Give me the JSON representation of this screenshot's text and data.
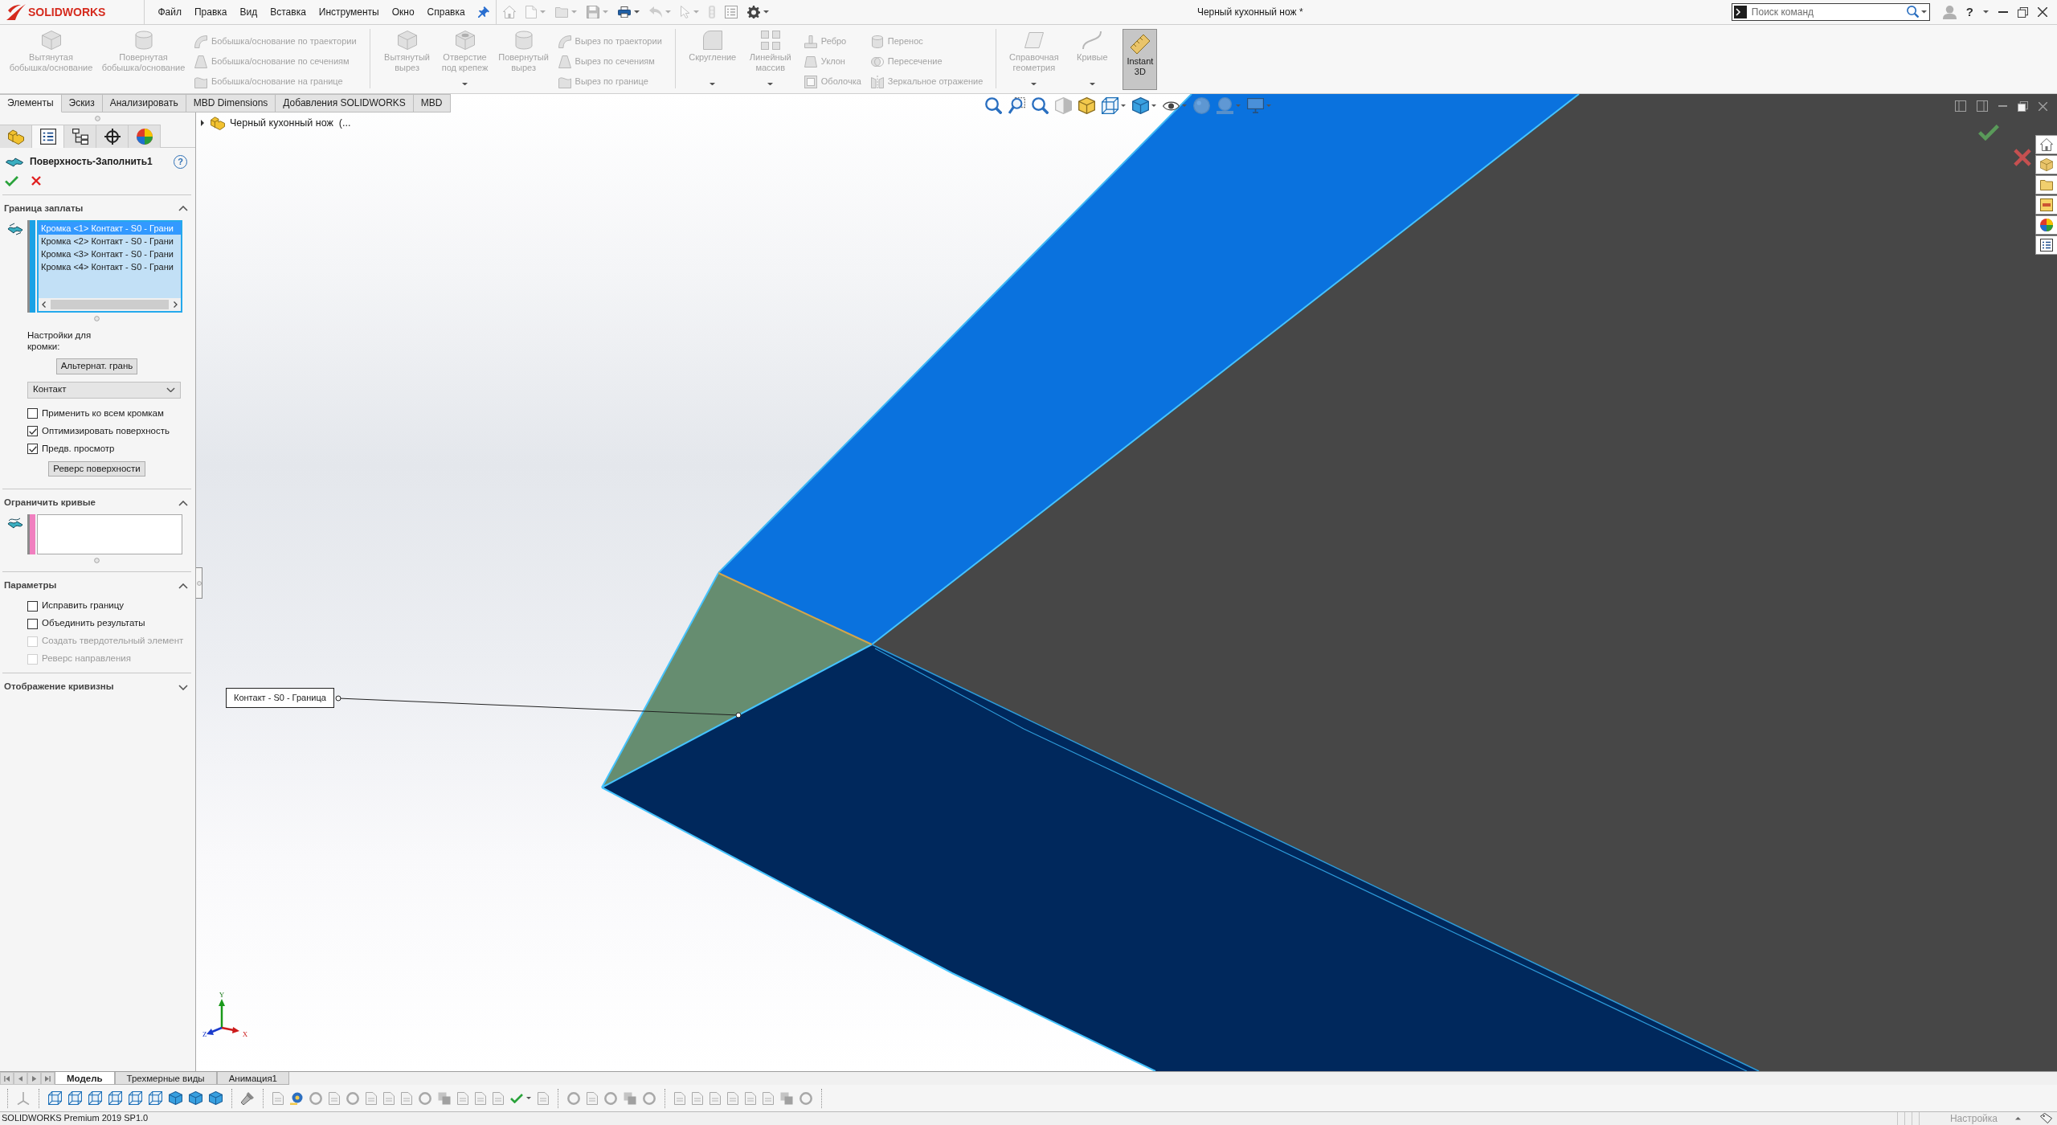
{
  "title_bar": {
    "logo_text": "SOLIDWORKS",
    "menu": [
      "Файл",
      "Правка",
      "Вид",
      "Вставка",
      "Инструменты",
      "Окно",
      "Справка"
    ],
    "document_title": "Черный кухонный нож *",
    "search": {
      "placeholder": "Поиск команд"
    },
    "help": "?"
  },
  "ribbon_groups": [
    [
      {
        "kind": "large",
        "label": "Вытянутая бобышка/основание",
        "disabled": true,
        "dropdown": false
      },
      {
        "kind": "large",
        "label": "Повернутая бобышка/основание",
        "disabled": true,
        "dropdown": false
      },
      {
        "kind": "stack",
        "items": [
          {
            "label": "Бобышка/основание по траектории",
            "disabled": true
          },
          {
            "label": "Бобышка/основание по сечениям",
            "disabled": true
          },
          {
            "label": "Бобышка/основание на границе",
            "disabled": true
          }
        ]
      }
    ],
    [
      {
        "kind": "large",
        "label": "Вытянутый вырез",
        "disabled": true,
        "dropdown": false
      },
      {
        "kind": "large",
        "label": "Отверстие под крепеж",
        "disabled": true,
        "dropdown": true
      },
      {
        "kind": "large",
        "label": "Повернутый вырез",
        "disabled": true,
        "dropdown": false
      },
      {
        "kind": "stack",
        "items": [
          {
            "label": "Вырез по траектории",
            "disabled": true
          },
          {
            "label": "Вырез по сечениям",
            "disabled": true
          },
          {
            "label": "Вырез по границе",
            "disabled": true
          }
        ]
      }
    ],
    [
      {
        "kind": "large",
        "label": "Скругление",
        "disabled": true,
        "dropdown": true
      },
      {
        "kind": "large",
        "label": "Линейный массив",
        "disabled": true,
        "dropdown": true
      },
      {
        "kind": "stack",
        "items": [
          {
            "label": "Ребро",
            "disabled": true
          },
          {
            "label": "Уклон",
            "disabled": true
          },
          {
            "label": "Оболочка",
            "disabled": true
          }
        ]
      },
      {
        "kind": "stack",
        "items": [
          {
            "label": "Перенос",
            "disabled": true
          },
          {
            "label": "Пересечение",
            "disabled": true
          },
          {
            "label": "Зеркальное отражение",
            "disabled": true
          }
        ]
      }
    ],
    [
      {
        "kind": "large",
        "label": "Справочная геометрия",
        "disabled": true,
        "dropdown": true
      },
      {
        "kind": "large",
        "label": "Кривые",
        "disabled": true,
        "dropdown": true
      },
      {
        "kind": "toggle",
        "label": "Instant 3D",
        "on": true
      }
    ]
  ],
  "command_tabs": [
    {
      "label": "Элементы",
      "selected": true
    },
    {
      "label": "Эскиз",
      "selected": false
    },
    {
      "label": "Анализировать",
      "selected": false
    },
    {
      "label": "MBD Dimensions",
      "selected": false
    },
    {
      "label": "Добавления SOLIDWORKS",
      "selected": false
    },
    {
      "label": "MBD",
      "selected": false
    }
  ],
  "property_manager": {
    "panel_tabs": [
      {
        "kind": "features",
        "selected": false
      },
      {
        "kind": "properties",
        "selected": true
      },
      {
        "kind": "configurations",
        "selected": false
      },
      {
        "kind": "dimxpert",
        "selected": false
      },
      {
        "kind": "display",
        "selected": false
      }
    ],
    "title": "Поверхность-Заполнить1",
    "help": "?",
    "sections": [
      {
        "kind": "patch_boundary",
        "title": "Граница заплаты",
        "expanded": true,
        "edges": [
          {
            "label": "Кромка <1> Контакт - S0 - Грани",
            "selected": true
          },
          {
            "label": "Кромка <2> Контакт - S0 - Грани",
            "selected": false
          },
          {
            "label": "Кромка <3> Контакт - S0 - Грани",
            "selected": false
          },
          {
            "label": "Кромка <4> Контакт - S0 - Грани",
            "selected": false
          }
        ],
        "edge_settings_label": "Настройки для кромки:",
        "alternate_button": "Альтернат. грань",
        "condition": "Контакт",
        "options": [
          {
            "label": "Применить ко всем кромкам",
            "checked": false,
            "disabled": false
          },
          {
            "label": "Оптимизировать поверхность",
            "checked": true,
            "disabled": false
          },
          {
            "label": "Предв. просмотр",
            "checked": true,
            "disabled": false
          }
        ],
        "reverse_button": "Реверс поверхности"
      },
      {
        "kind": "constraint_curves",
        "title": "Ограничить кривые",
        "expanded": true
      },
      {
        "kind": "parameters",
        "title": "Параметры",
        "expanded": true,
        "options": [
          {
            "label": "Исправить границу",
            "checked": false,
            "disabled": false
          },
          {
            "label": "Объединить результаты",
            "checked": false,
            "disabled": false
          },
          {
            "label": "Создать твердотельный элемент",
            "checked": false,
            "disabled": true
          },
          {
            "label": "Реверс направления",
            "checked": false,
            "disabled": true
          }
        ]
      },
      {
        "title": "Отображение кривизны",
        "expanded": false
      }
    ]
  },
  "graphics": {
    "tree_root": "Черный кухонный нож  (...",
    "callout": "Контакт - S0 - Граница",
    "triad": {
      "x": "X",
      "y": "Y",
      "z": "Z"
    }
  },
  "bottom_tabs": [
    {
      "label": "Модель",
      "selected": true
    },
    {
      "label": "Трехмерные виды",
      "selected": false
    },
    {
      "label": "Анимация1",
      "selected": false
    }
  ],
  "status_bar": {
    "product": "SOLIDWORKS Premium 2019 SP1.0",
    "units": "Настройка"
  }
}
